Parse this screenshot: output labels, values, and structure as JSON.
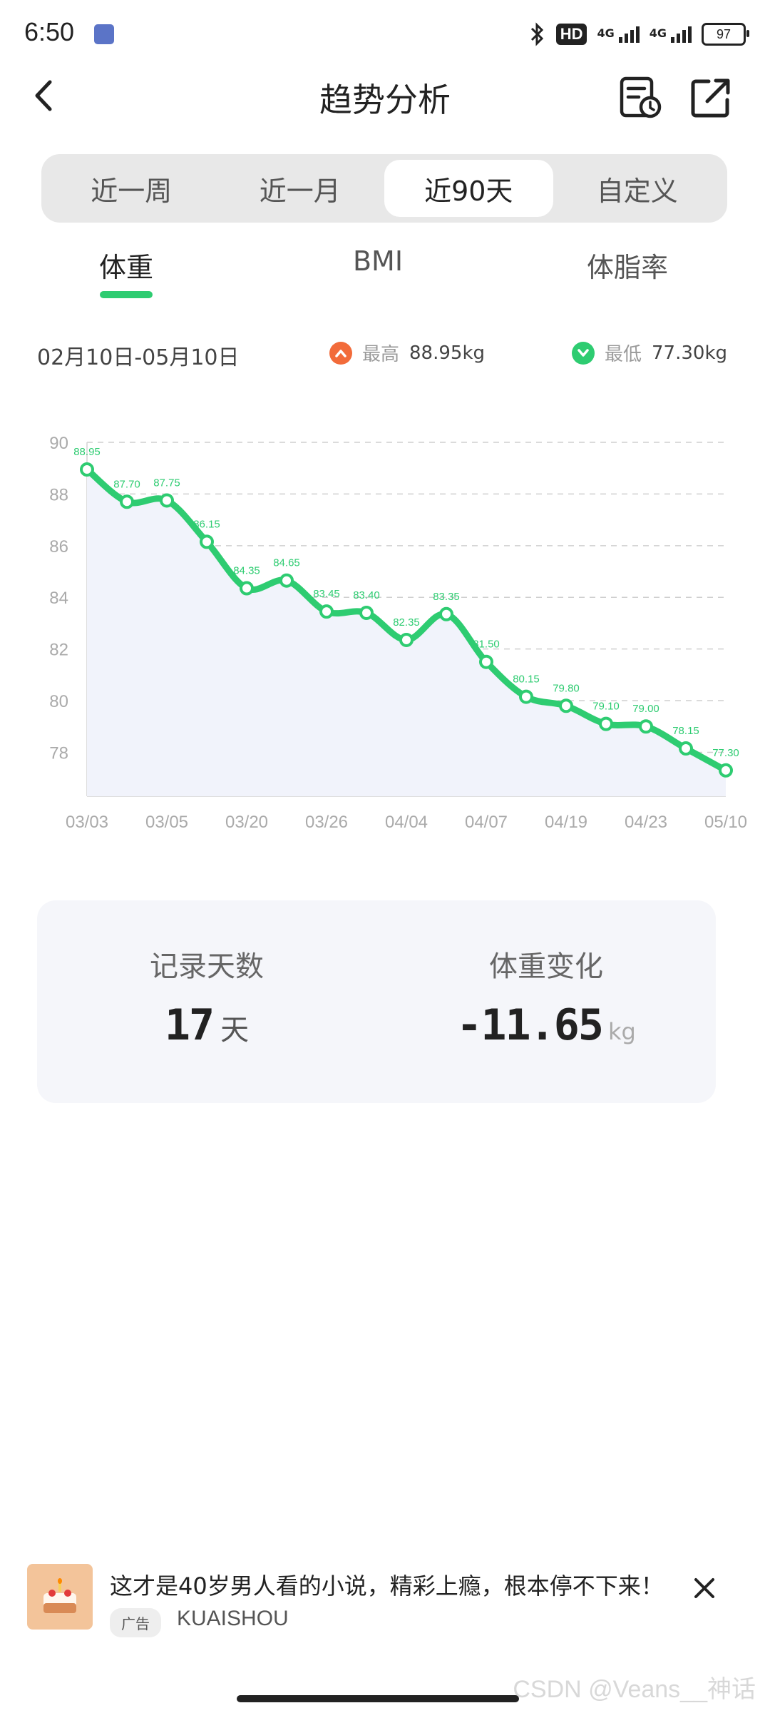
{
  "status_bar": {
    "time": "6:50",
    "hd": "HD",
    "net1": "4G",
    "net2": "4G",
    "battery": "97"
  },
  "header": {
    "title": "趋势分析"
  },
  "range_tabs": [
    {
      "label": "近一周"
    },
    {
      "label": "近一月"
    },
    {
      "label": "近90天",
      "active": true
    },
    {
      "label": "自定义"
    }
  ],
  "metric_tabs": [
    {
      "label": "体重",
      "active": true
    },
    {
      "label": "BMI"
    },
    {
      "label": "体脂率"
    }
  ],
  "stats": {
    "date_range": "02月10日-05月10日",
    "max_label": "最高",
    "max_value": "88.95kg",
    "min_label": "最低",
    "min_value": "77.30kg"
  },
  "chart_data": {
    "type": "line",
    "x_labels": [
      "03/03",
      "03/05",
      "03/20",
      "03/26",
      "04/04",
      "04/07",
      "04/19",
      "04/23",
      "05/10"
    ],
    "values": [
      88.95,
      87.7,
      87.75,
      86.15,
      84.35,
      84.65,
      83.45,
      83.4,
      82.35,
      83.35,
      81.5,
      80.15,
      79.8,
      79.1,
      79.0,
      78.15,
      77.3
    ],
    "value_labels": [
      "88.95",
      "87.70",
      "87.75",
      "86.15",
      "84.35",
      "84.65",
      "83.45",
      "83.40",
      "82.35",
      "83.35",
      "81.50",
      "80.15",
      "79.80",
      "79.10",
      "79.00",
      "78.15",
      "77.30"
    ],
    "y_ticks": [
      90,
      88,
      86,
      84,
      82,
      80,
      78
    ],
    "ylim": [
      76.3,
      90
    ],
    "grid": true,
    "line_color": "#2ecc71",
    "fill_color": "#f1f3fb"
  },
  "summary": {
    "days_label": "记录天数",
    "days_value": "17",
    "days_unit": "天",
    "change_label": "体重变化",
    "change_value": "-11.65",
    "change_unit": "kg"
  },
  "ad": {
    "text": "这才是40岁男人看的小说，精彩上瘾，根本停不下来！",
    "badge": "广告",
    "brand": "KUAISHOU"
  },
  "watermark": "CSDN @Veans__神话",
  "icons": [
    "back-icon",
    "record-history-icon",
    "share-icon",
    "arrow-up-icon",
    "check-icon",
    "close-icon",
    "bluetooth-icon"
  ],
  "colors": {
    "accent": "#2ecc71",
    "max": "#f26b3a",
    "min": "#2ecc71"
  }
}
